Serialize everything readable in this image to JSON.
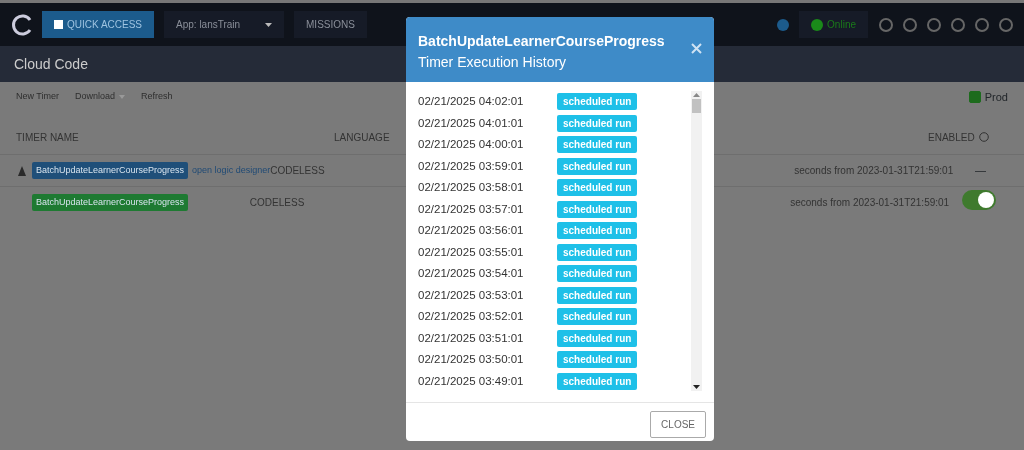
{
  "navbar": {
    "quick_access": "QUICK ACCESS",
    "app_selector": "App: lansTrain",
    "missions": "MISSIONS",
    "status": "Online"
  },
  "page_title": "Cloud Code",
  "toolbar": [
    {
      "label": "New Timer",
      "kind": "link"
    },
    {
      "label": "Download",
      "kind": "dropdown"
    },
    {
      "label": "Refresh",
      "kind": "link"
    }
  ],
  "production": {
    "label": "Prod",
    "checked": true
  },
  "table": {
    "columns": [
      "TIMER NAME",
      "LANGUAGE",
      "ENABLED"
    ],
    "rows": [
      {
        "name": "BatchUpdateLearnerCourseProgress",
        "color": "#1f4f79",
        "has_icon": true,
        "link": "open logic designer",
        "language": "CODELESS",
        "schedule": "seconds from 2023-01-31T21:59:01",
        "enabled": "—"
      },
      {
        "name": "BatchUpdateLearnerCourseProgress",
        "color": "#1e7a32",
        "has_icon": false,
        "language": "CODELESS",
        "schedule": "seconds from 2023-01-31T21:59:01",
        "on": true
      }
    ]
  },
  "modal": {
    "title": "BatchUpdateLearnerCourseProgress",
    "subtitle": "Timer Execution History",
    "close": "CLOSE",
    "entries": [
      {
        "time": "02/21/2025 04:02:01",
        "tag": "scheduled run"
      },
      {
        "time": "02/21/2025 04:01:01",
        "tag": "scheduled run"
      },
      {
        "time": "02/21/2025 04:00:01",
        "tag": "scheduled run"
      },
      {
        "time": "02/21/2025 03:59:01",
        "tag": "scheduled run"
      },
      {
        "time": "02/21/2025 03:58:01",
        "tag": "scheduled run"
      },
      {
        "time": "02/21/2025 03:57:01",
        "tag": "scheduled run"
      },
      {
        "time": "02/21/2025 03:56:01",
        "tag": "scheduled run"
      },
      {
        "time": "02/21/2025 03:55:01",
        "tag": "scheduled run"
      },
      {
        "time": "02/21/2025 03:54:01",
        "tag": "scheduled run"
      },
      {
        "time": "02/21/2025 03:53:01",
        "tag": "scheduled run"
      },
      {
        "time": "02/21/2025 03:52:01",
        "tag": "scheduled run"
      },
      {
        "time": "02/21/2025 03:51:01",
        "tag": "scheduled run"
      },
      {
        "time": "02/21/2025 03:50:01",
        "tag": "scheduled run"
      },
      {
        "time": "02/21/2025 03:49:01",
        "tag": "scheduled run"
      }
    ]
  }
}
